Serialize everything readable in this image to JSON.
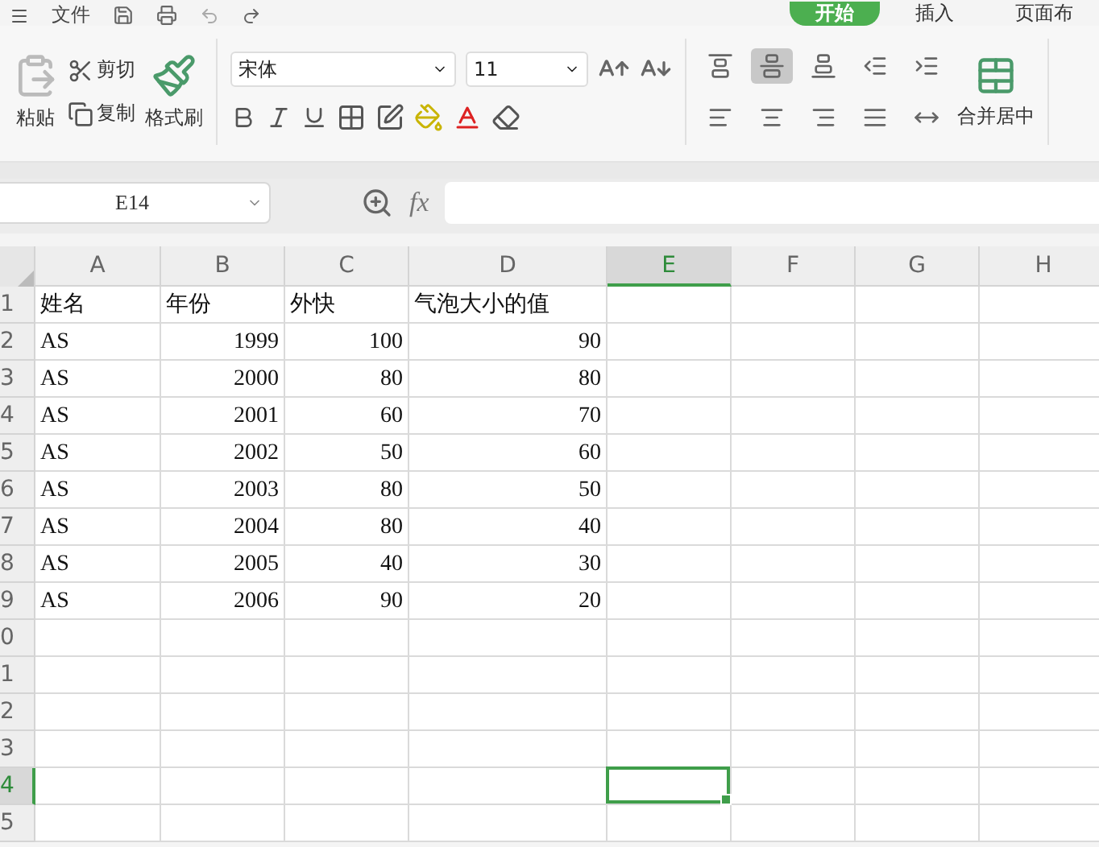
{
  "menu": {
    "file": "文件"
  },
  "tabs": [
    {
      "label": "开始",
      "selected": true
    },
    {
      "label": "插入",
      "selected": false
    },
    {
      "label": "页面布",
      "selected": false
    }
  ],
  "clipboard": {
    "paste": "粘贴",
    "cut": "剪切",
    "copy": "复制",
    "format_painter": "格式刷"
  },
  "font": {
    "name": "宋体",
    "size": "11"
  },
  "alignment": [
    {
      "kind": "top",
      "selected": false
    },
    {
      "kind": "middle",
      "selected": true
    },
    {
      "kind": "bottom",
      "selected": false
    },
    {
      "kind": "outdent",
      "selected": false
    },
    {
      "kind": "indent",
      "selected": false
    }
  ],
  "merge": {
    "label": "合并居中"
  },
  "formula_bar": {
    "name_box": "E14",
    "fx": "fx"
  },
  "sheet": {
    "columns": [
      {
        "label": "A",
        "numeric": false,
        "selected": false
      },
      {
        "label": "B",
        "numeric": true,
        "selected": false
      },
      {
        "label": "C",
        "numeric": true,
        "selected": false
      },
      {
        "label": "D",
        "numeric": true,
        "selected": false
      },
      {
        "label": "E",
        "numeric": false,
        "selected": true
      },
      {
        "label": "F",
        "numeric": false,
        "selected": false
      },
      {
        "label": "G",
        "numeric": false,
        "selected": false
      },
      {
        "label": "H",
        "numeric": false,
        "selected": false
      }
    ],
    "rows": [
      {
        "number": "1",
        "kind": "header",
        "selected": false,
        "cells": [
          "姓名",
          "年份",
          "外快",
          "气泡大小的值"
        ]
      },
      {
        "number": "2",
        "kind": "data",
        "selected": false,
        "cells": [
          "AS",
          "1999",
          "100",
          "90"
        ]
      },
      {
        "number": "3",
        "kind": "data",
        "selected": false,
        "cells": [
          "AS",
          "2000",
          "80",
          "80"
        ]
      },
      {
        "number": "4",
        "kind": "data",
        "selected": false,
        "cells": [
          "AS",
          "2001",
          "60",
          "70"
        ]
      },
      {
        "number": "5",
        "kind": "data",
        "selected": false,
        "cells": [
          "AS",
          "2002",
          "50",
          "60"
        ]
      },
      {
        "number": "6",
        "kind": "data",
        "selected": false,
        "cells": [
          "AS",
          "2003",
          "80",
          "50"
        ]
      },
      {
        "number": "7",
        "kind": "data",
        "selected": false,
        "cells": [
          "AS",
          "2004",
          "80",
          "40"
        ]
      },
      {
        "number": "8",
        "kind": "data",
        "selected": false,
        "cells": [
          "AS",
          "2005",
          "40",
          "30"
        ]
      },
      {
        "number": "9",
        "kind": "data",
        "selected": false,
        "cells": [
          "AS",
          "2006",
          "90",
          "20"
        ]
      },
      {
        "number": "0",
        "kind": "data",
        "selected": false,
        "cells": []
      },
      {
        "number": "1",
        "kind": "data",
        "selected": false,
        "cells": []
      },
      {
        "number": "2",
        "kind": "data",
        "selected": false,
        "cells": []
      },
      {
        "number": "3",
        "kind": "data",
        "selected": false,
        "cells": []
      },
      {
        "number": "4",
        "kind": "data",
        "selected": true,
        "cells": []
      },
      {
        "number": "5",
        "kind": "data",
        "selected": false,
        "cells": []
      }
    ]
  }
}
